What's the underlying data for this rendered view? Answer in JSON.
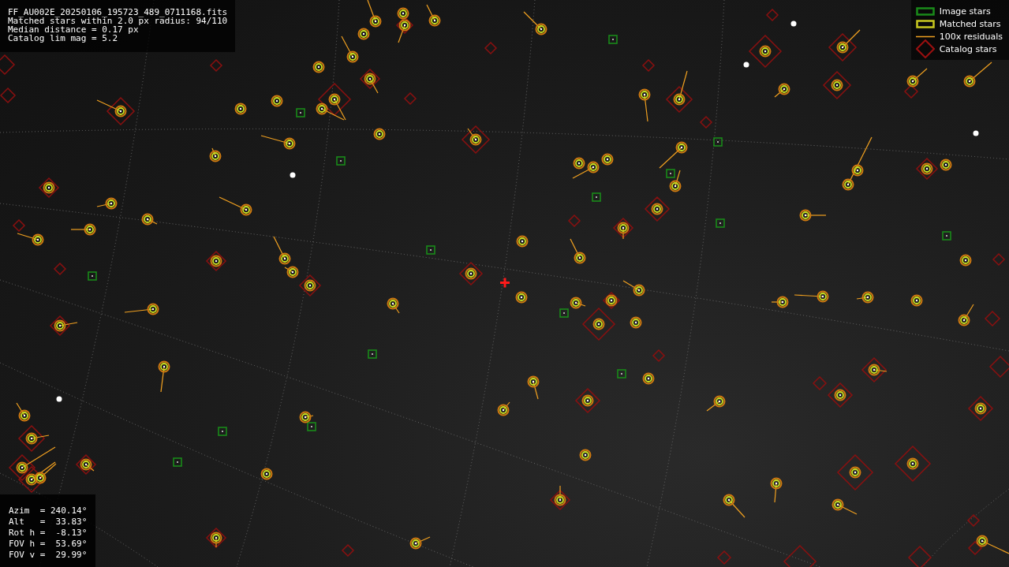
{
  "file_info": {
    "lines": [
      "FF_AU002E_20250106_195723_489_0711168.fits",
      "Matched stars within 2.0 px radius: 94/110",
      "Median distance = 0.17 px",
      "Catalog lim mag = 5.2"
    ]
  },
  "legend": {
    "entries": [
      {
        "kind": "image",
        "label": "Image stars"
      },
      {
        "kind": "matched",
        "label": "Matched stars"
      },
      {
        "kind": "residual",
        "label": "100x residuals"
      },
      {
        "kind": "catalog",
        "label": "Catalog stars"
      }
    ]
  },
  "camera": {
    "lines": [
      "Azim  = 240.14°",
      "Alt   =  33.83°",
      "Rot h =  -8.13°",
      "FOV h =  53.69°",
      "FOV v =  29.99°"
    ]
  }
}
